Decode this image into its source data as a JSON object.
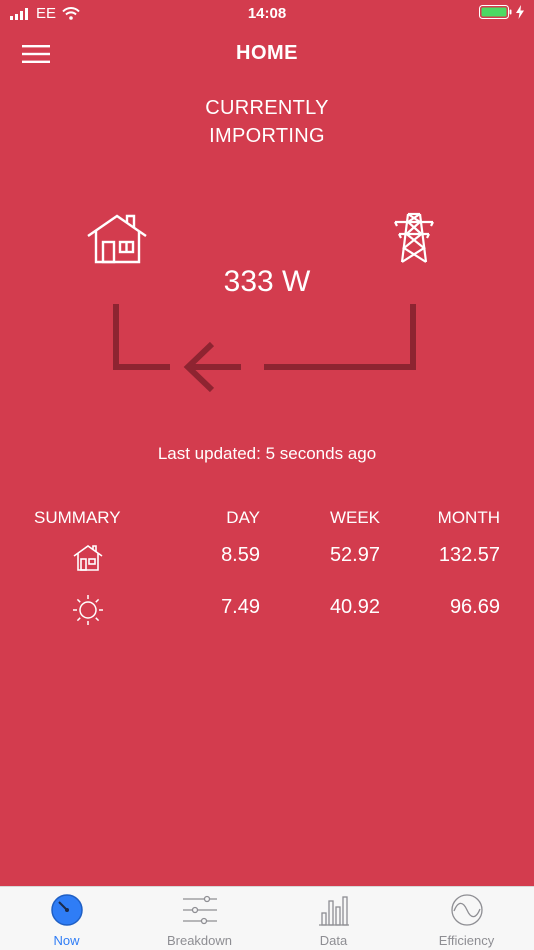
{
  "status_bar": {
    "carrier": "EE",
    "time": "14:08",
    "battery_color": "#4cd964"
  },
  "nav": {
    "title": "HOME",
    "menu_icon": "hamburger-menu-icon"
  },
  "status": {
    "line1": "CURRENTLY",
    "line2": "IMPORTING"
  },
  "flow": {
    "power": "333 W",
    "direction": "grid-to-home",
    "source_icon": "pylon-icon",
    "destination_icon": "house-icon"
  },
  "last_updated": "Last updated: 5 seconds ago",
  "summary": {
    "header": "SUMMARY",
    "columns": [
      "DAY",
      "WEEK",
      "MONTH"
    ],
    "rows": [
      {
        "icon": "house-icon",
        "values": [
          "8.59",
          "52.97",
          "132.57"
        ]
      },
      {
        "icon": "sun-icon",
        "values": [
          "7.49",
          "40.92",
          "96.69"
        ]
      }
    ]
  },
  "tabs": [
    {
      "label": "Now",
      "icon": "gauge-icon",
      "active": true
    },
    {
      "label": "Breakdown",
      "icon": "sliders-icon",
      "active": false
    },
    {
      "label": "Data",
      "icon": "bar-chart-icon",
      "active": false
    },
    {
      "label": "Efficiency",
      "icon": "wave-icon",
      "active": false
    }
  ],
  "colors": {
    "background": "#d33c4e",
    "flow_line": "#8e2431",
    "tab_active": "#2f7df6",
    "tab_inactive": "#8e8e93"
  }
}
